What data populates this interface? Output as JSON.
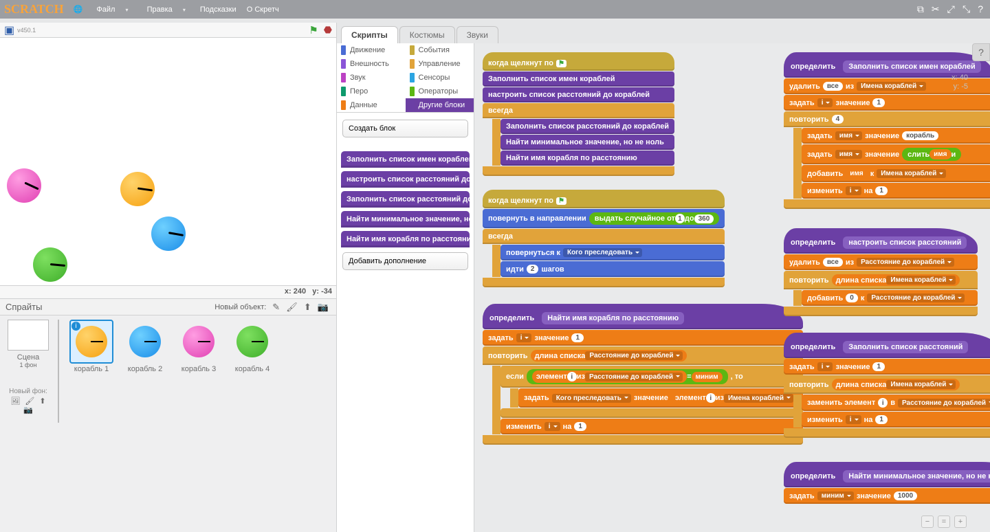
{
  "app": {
    "logo": "SCRATCH",
    "version": "v450.1"
  },
  "menu": {
    "file": "Файл",
    "edit": "Правка",
    "tips": "Подсказки",
    "about": "О Скретч"
  },
  "stage": {
    "coords": {
      "xlabel": "x:",
      "x": "240",
      "ylabel": "y:",
      "y": "-34"
    }
  },
  "sprites": {
    "header": "Спрайты",
    "newobject": "Новый объект:",
    "scene": {
      "label": "Сцена",
      "sub": "1 фон",
      "newbg": "Новый фон:"
    },
    "list": [
      {
        "name": "корабль 1"
      },
      {
        "name": "корабль 2"
      },
      {
        "name": "корабль 3"
      },
      {
        "name": "корабль 4"
      }
    ]
  },
  "tabs": {
    "scripts": "Скрипты",
    "costumes": "Костюмы",
    "sounds": "Звуки"
  },
  "cats": {
    "motion": "Движение",
    "looks": "Внешность",
    "sound": "Звук",
    "pen": "Перо",
    "data": "Данные",
    "events": "События",
    "control": "Управление",
    "sensing": "Сенсоры",
    "operators": "Операторы",
    "more": "Другие блоки"
  },
  "palette": {
    "make": "Создать блок",
    "addext": "Добавить дополнение",
    "blocks": [
      "Заполнить список имен кораблей",
      "настроить список расстояний до ко",
      "Заполнить список расстояний до ко",
      "Найти минимальное значение, но н",
      "Найти имя корабля по расстоянию"
    ]
  },
  "readout": {
    "x": "x: 40",
    "y": "y: -5"
  },
  "txt": {
    "whenFlag": "когда щелкнут по",
    "fillNames": "Заполнить список имен кораблей",
    "setupDist": "настроить список расстояний до кораблей",
    "forever": "всегда",
    "fillDist": "Заполнить список расстояний до кораблей",
    "findMin": "Найти минимальное значение, но не ноль",
    "findName": "Найти имя корабля по расстоянию",
    "pointDir": "повернуть в направлении",
    "randBetween": "выдать случайное от",
    "randTo": "до",
    "pointTo": "повернуться к",
    "whoChase": "Кого преследовать",
    "move": "идти",
    "steps": "шагов",
    "define": "определить",
    "set": "задать",
    "value": "значение",
    "repeat": "повторить",
    "lenOf": "длина списка",
    "if": "если",
    "then": ", то",
    "itemOf": "элемент",
    "of": "из",
    "change": "изменить",
    "by": "на",
    "delete": "удалить",
    "all": "все",
    "add": "добавить",
    "to": "к",
    "join": "слить",
    "and": "и",
    "replace": "заменить элемент",
    "in": "в",
    "eq": "=",
    "distList": "Расстояние до кораблей",
    "nameList": "Имена кораблей",
    "min": "миним",
    "name": "имя",
    "ship": "корабль",
    "defSetupDist": "настроить список расстояний",
    "defFillDist": "Заполнить список расстояний",
    "defFindMin": "Найти минимальное значение, но не ноль",
    "n1": "1",
    "n2": "2",
    "n4": "4",
    "n0": "0",
    "n360": "360",
    "n1000": "1000"
  }
}
